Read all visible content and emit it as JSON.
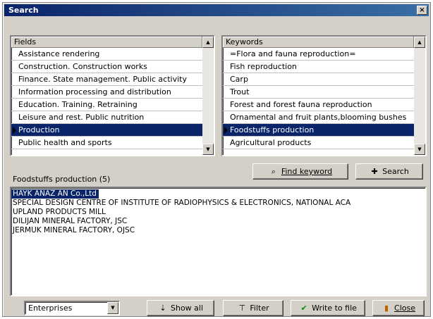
{
  "window": {
    "title": "Search",
    "close_glyph": "×"
  },
  "fields": {
    "header": "Fields",
    "items": [
      "Assistance rendering",
      "Construction. Construction works",
      "Finance. State management. Public activity",
      "Information processing and distribution",
      "Education. Training. Retraining",
      "Leisure and rest. Public nutrition",
      "Production",
      "Public health and sports"
    ],
    "selected_index": 6
  },
  "keywords": {
    "header": "Keywords",
    "items": [
      "=Flora and fauna reproduction=",
      "  Fish reproduction",
      "Carp",
      "Trout",
      "Forest and forest fauna reproduction",
      "Ornamental and fruit plants,blooming bushes",
      "Foodstuffs production",
      "Agricultural products"
    ],
    "selected_index": 6
  },
  "buttons": {
    "find_keyword": "Find keyword",
    "search": "Search",
    "show_all": "Show all",
    "filter": "Filter",
    "write_to_file": "Write to file",
    "close": "Close"
  },
  "results": {
    "caption": "Foodstuffs production (5)",
    "items": [
      "HAYK ANAZ AN Co.,Ltd",
      "SPECIAL DESIGN CENTRE OF INSTITUTE OF RADIOPHYSICS & ELECTRONICS, NATIONAL ACA",
      "UPLAND PRODUCTS MILL",
      "DILIJAN MINERAL FACTORY, JSC",
      "JERMUK MINERAL FACTORY, OJSC"
    ],
    "selected_index": 0
  },
  "type_select": {
    "value": "Enterprises"
  },
  "icons": {
    "find": "find-icon",
    "search": "search-icon",
    "show_all": "show-all-icon",
    "filter": "filter-icon",
    "write": "checkmark-icon",
    "close": "door-icon"
  },
  "colors": {
    "selection": "#0a246a",
    "titlebar": "#0a246a",
    "face": "#d4d0c8"
  }
}
